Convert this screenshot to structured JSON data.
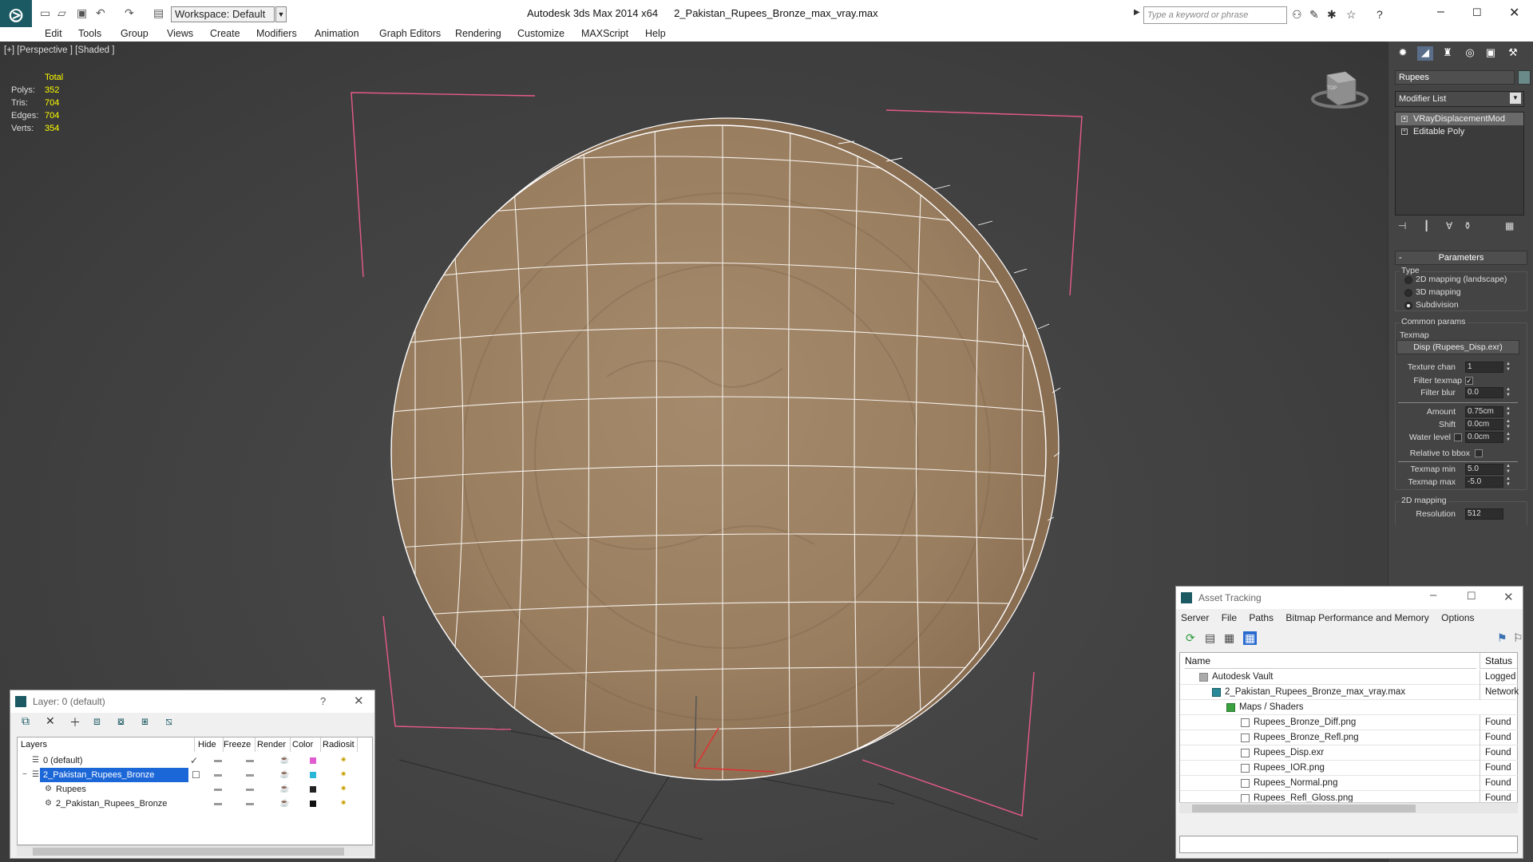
{
  "titlebar": {
    "app_name": "Autodesk 3ds Max  2014 x64",
    "file_name": "2_Pakistan_Rupees_Bronze_max_vray.max",
    "workspace": "Workspace: Default",
    "search_placeholder": "Type a keyword or phrase"
  },
  "menu": [
    "Edit",
    "Tools",
    "Group",
    "Views",
    "Create",
    "Modifiers",
    "Animation",
    "Graph Editors",
    "Rendering",
    "Customize",
    "MAXScript",
    "Help"
  ],
  "viewport": {
    "label": "[+] [Perspective ] [Shaded ]",
    "stats": {
      "total_label": "Total",
      "rows": [
        {
          "label": "Polys:",
          "value": "352"
        },
        {
          "label": "Tris:",
          "value": "704"
        },
        {
          "label": "Edges:",
          "value": "704"
        },
        {
          "label": "Verts:",
          "value": "354"
        }
      ]
    },
    "viewcube_label": "TOP"
  },
  "command_panel": {
    "object_name": "Rupees",
    "modifier_list": "Modifier List",
    "stack": [
      "VRayDisplacementMod",
      "Editable Poly"
    ],
    "rollout": "Parameters",
    "type_group": "Type",
    "type_options": [
      "2D mapping (landscape)",
      "3D mapping",
      "Subdivision"
    ],
    "common_group": "Common params",
    "texmap_label": "Texmap",
    "texmap_button": "Disp (Rupees_Disp.exr)",
    "params": {
      "texture_chan_label": "Texture chan",
      "texture_chan": "1",
      "filter_texmap_label": "Filter texmap",
      "filter_blur_label": "Filter blur",
      "filter_blur": "0.0",
      "amount_label": "Amount",
      "amount": "0.75cm",
      "shift_label": "Shift",
      "shift": "0.0cm",
      "water_level_label": "Water level",
      "water_level": "0.0cm",
      "relative_bbox_label": "Relative to bbox",
      "texmap_min_label": "Texmap min",
      "texmap_min": "5.0",
      "texmap_max_label": "Texmap max",
      "texmap_max": "-5.0"
    },
    "mapping2d_group": "2D mapping",
    "resolution_label": "Resolution",
    "resolution": "512"
  },
  "layer_dialog": {
    "title": "Layer: 0 (default)",
    "help": "?",
    "columns": [
      "Layers",
      "Hide",
      "Freeze",
      "Render",
      "Color",
      "Radiosit"
    ],
    "rows": [
      {
        "name": "0 (default)",
        "color": "#e05ad0"
      },
      {
        "name": "2_Pakistan_Rupees_Bronze",
        "color": "#2ab6d6"
      },
      {
        "name": "Rupees",
        "color": "#222222"
      },
      {
        "name": "2_Pakistan_Rupees_Bronze",
        "color": "#111111"
      }
    ]
  },
  "asset_tracking": {
    "title": "Asset Tracking",
    "menu": [
      "Server",
      "File",
      "Paths",
      "Bitmap Performance and Memory",
      "Options"
    ],
    "columns": [
      "Name",
      "Status"
    ],
    "rows": [
      {
        "name": "Autodesk Vault",
        "status": "Logged O"
      },
      {
        "name": "2_Pakistan_Rupees_Bronze_max_vray.max",
        "status": "Network F"
      },
      {
        "name": "Maps / Shaders",
        "status": ""
      },
      {
        "name": "Rupees_Bronze_Diff.png",
        "status": "Found"
      },
      {
        "name": "Rupees_Bronze_Refl.png",
        "status": "Found"
      },
      {
        "name": "Rupees_Disp.exr",
        "status": "Found"
      },
      {
        "name": "Rupees_IOR.png",
        "status": "Found"
      },
      {
        "name": "Rupees_Normal.png",
        "status": "Found"
      },
      {
        "name": "Rupees_Refl_Gloss.png",
        "status": "Found"
      }
    ]
  }
}
